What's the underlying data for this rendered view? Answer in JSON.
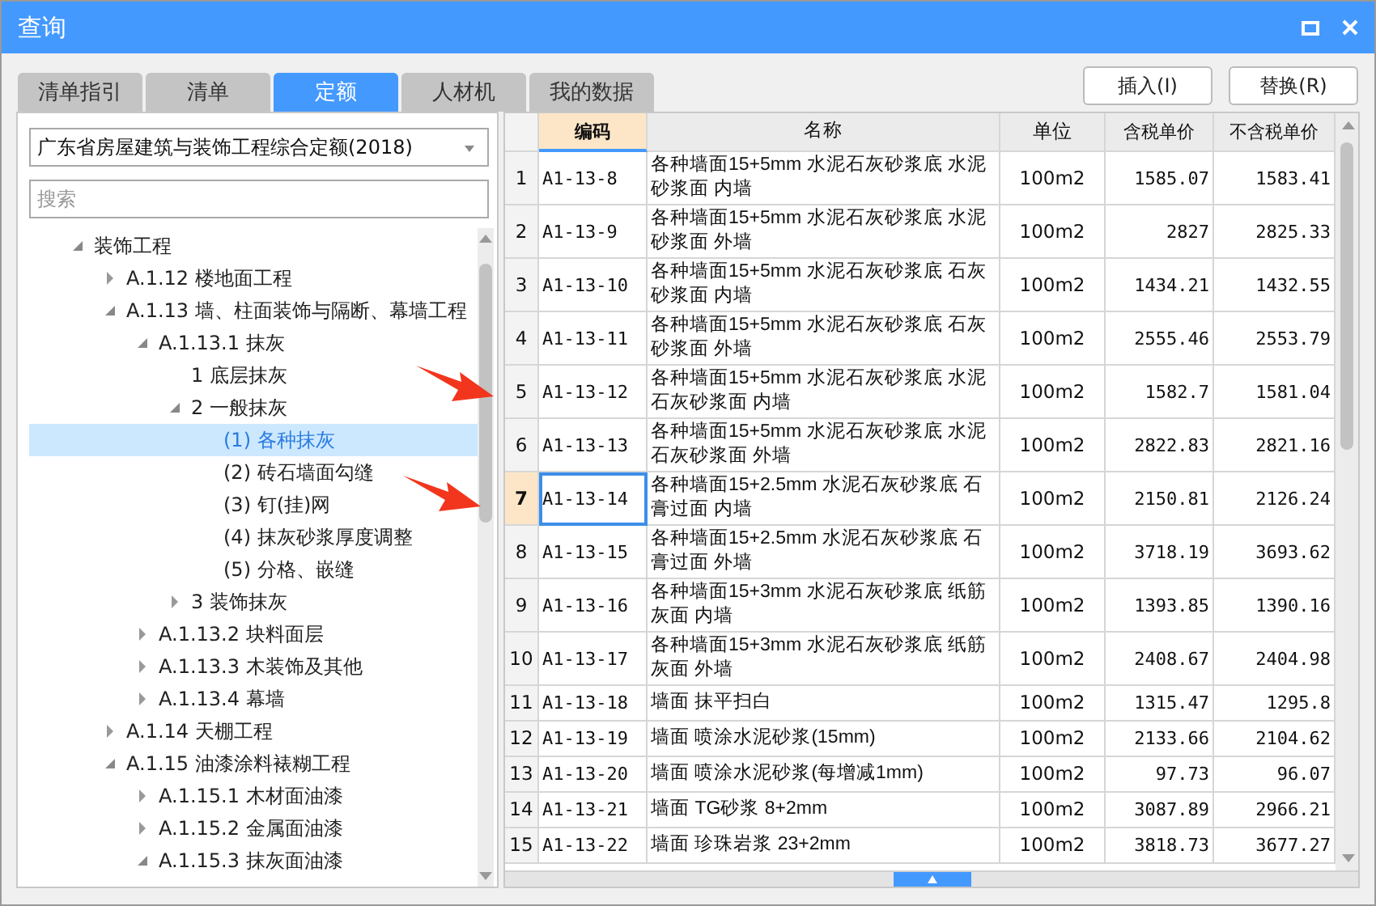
{
  "window": {
    "title": "查询"
  },
  "tabs": [
    {
      "label": "清单指引",
      "selected": false
    },
    {
      "label": "清单",
      "selected": false
    },
    {
      "label": "定额",
      "selected": true
    },
    {
      "label": "人材机",
      "selected": false
    },
    {
      "label": "我的数据",
      "selected": false
    }
  ],
  "buttons": [
    "插入(I)",
    "替换(R)"
  ],
  "library_select": {
    "value": "广东省房屋建筑与装饰工程综合定额(2018)"
  },
  "search": {
    "placeholder": "搜索"
  },
  "tree": [
    {
      "label": "装饰工程",
      "expanded": true,
      "selected": false,
      "children": [
        {
          "label": "A.1.12 楼地面工程",
          "expanded": false,
          "selected": false
        },
        {
          "label": "A.1.13 墙、柱面装饰与隔断、幕墙工程",
          "expanded": true,
          "selected": false,
          "children": [
            {
              "label": "A.1.13.1 抹灰",
              "expanded": true,
              "selected": false,
              "children": [
                {
                  "label": "1 底层抹灰",
                  "selected": false
                },
                {
                  "label": "2 一般抹灰",
                  "expanded": true,
                  "selected": false,
                  "children": [
                    {
                      "label": "(1) 各种抹灰",
                      "selected": true
                    },
                    {
                      "label": "(2) 砖石墙面勾缝",
                      "selected": false
                    },
                    {
                      "label": "(3) 钉(挂)网",
                      "selected": false
                    },
                    {
                      "label": "(4) 抹灰砂浆厚度调整",
                      "selected": false
                    },
                    {
                      "label": "(5) 分格、嵌缝",
                      "selected": false
                    }
                  ]
                },
                {
                  "label": "3 装饰抹灰",
                  "expanded": false,
                  "selected": false
                }
              ]
            },
            {
              "label": "A.1.13.2 块料面层",
              "expanded": false,
              "selected": false
            },
            {
              "label": "A.1.13.3 木装饰及其他",
              "expanded": false,
              "selected": false
            },
            {
              "label": "A.1.13.4 幕墙",
              "expanded": false,
              "selected": false
            }
          ]
        },
        {
          "label": "A.1.14 天棚工程",
          "expanded": false,
          "selected": false
        },
        {
          "label": "A.1.15 油漆涂料裱糊工程",
          "expanded": true,
          "selected": false,
          "children": [
            {
              "label": "A.1.15.1 木材面油漆",
              "expanded": false,
              "selected": false
            },
            {
              "label": "A.1.15.2 金属面油漆",
              "expanded": false,
              "selected": false
            },
            {
              "label": "A.1.15.3 抹灰面油漆",
              "expanded": true,
              "selected": false
            }
          ]
        }
      ]
    }
  ],
  "table": {
    "columns": [
      {
        "label": "编码",
        "selected": true
      },
      {
        "label": "名称",
        "selected": false
      },
      {
        "label": "单位",
        "selected": false
      },
      {
        "label": "含税单价",
        "selected": false
      },
      {
        "label": "不含税单价",
        "selected": false
      }
    ],
    "rows": [
      {
        "no": "1",
        "code": "A1-13-8",
        "name": "各种墙面15+5mm 水泥石灰砂浆底 水泥砂浆面 内墙",
        "unit": "100m2",
        "price_tax": "1585.07",
        "price_notax": "1583.41",
        "selected": false
      },
      {
        "no": "2",
        "code": "A1-13-9",
        "name": "各种墙面15+5mm 水泥石灰砂浆底 水泥砂浆面 外墙",
        "unit": "100m2",
        "price_tax": "2827",
        "price_notax": "2825.33",
        "selected": false
      },
      {
        "no": "3",
        "code": "A1-13-10",
        "name": "各种墙面15+5mm 水泥石灰砂浆底 石灰砂浆面 内墙",
        "unit": "100m2",
        "price_tax": "1434.21",
        "price_notax": "1432.55",
        "selected": false
      },
      {
        "no": "4",
        "code": "A1-13-11",
        "name": "各种墙面15+5mm 水泥石灰砂浆底 石灰砂浆面 外墙",
        "unit": "100m2",
        "price_tax": "2555.46",
        "price_notax": "2553.79",
        "selected": false
      },
      {
        "no": "5",
        "code": "A1-13-12",
        "name": "各种墙面15+5mm 水泥石灰砂浆底 水泥石灰砂浆面 内墙",
        "unit": "100m2",
        "price_tax": "1582.7",
        "price_notax": "1581.04",
        "selected": false
      },
      {
        "no": "6",
        "code": "A1-13-13",
        "name": "各种墙面15+5mm 水泥石灰砂浆底 水泥石灰砂浆面 外墙",
        "unit": "100m2",
        "price_tax": "2822.83",
        "price_notax": "2821.16",
        "selected": false
      },
      {
        "no": "7",
        "code": "A1-13-14",
        "name": "各种墙面15+2.5mm 水泥石灰砂浆底 石膏过面 内墙",
        "unit": "100m2",
        "price_tax": "2150.81",
        "price_notax": "2126.24",
        "selected": true
      },
      {
        "no": "8",
        "code": "A1-13-15",
        "name": "各种墙面15+2.5mm 水泥石灰砂浆底 石膏过面 外墙",
        "unit": "100m2",
        "price_tax": "3718.19",
        "price_notax": "3693.62",
        "selected": false
      },
      {
        "no": "9",
        "code": "A1-13-16",
        "name": "各种墙面15+3mm 水泥石灰砂浆底 纸筋灰面 内墙",
        "unit": "100m2",
        "price_tax": "1393.85",
        "price_notax": "1390.16",
        "selected": false
      },
      {
        "no": "10",
        "code": "A1-13-17",
        "name": "各种墙面15+3mm 水泥石灰砂浆底 纸筋灰面 外墙",
        "unit": "100m2",
        "price_tax": "2408.67",
        "price_notax": "2404.98",
        "selected": false
      },
      {
        "no": "11",
        "code": "A1-13-18",
        "name": "墙面 抹平扫白",
        "unit": "100m2",
        "price_tax": "1315.47",
        "price_notax": "1295.8",
        "selected": false
      },
      {
        "no": "12",
        "code": "A1-13-19",
        "name": "墙面 喷涂水泥砂浆(15mm)",
        "unit": "100m2",
        "price_tax": "2133.66",
        "price_notax": "2104.62",
        "selected": false
      },
      {
        "no": "13",
        "code": "A1-13-20",
        "name": "墙面 喷涂水泥砂浆(每增减1mm)",
        "unit": "100m2",
        "price_tax": "97.73",
        "price_notax": "96.07",
        "selected": false
      },
      {
        "no": "14",
        "code": "A1-13-21",
        "name": "墙面 TG砂浆 8+2mm",
        "unit": "100m2",
        "price_tax": "3087.89",
        "price_notax": "2966.21",
        "selected": false
      },
      {
        "no": "15",
        "code": "A1-13-22",
        "name": "墙面 珍珠岩浆 23+2mm",
        "unit": "100m2",
        "price_tax": "3818.73",
        "price_notax": "3677.27",
        "selected": false
      }
    ]
  },
  "annotations": [
    {
      "kind": "arrow"
    },
    {
      "kind": "arrow"
    }
  ]
}
